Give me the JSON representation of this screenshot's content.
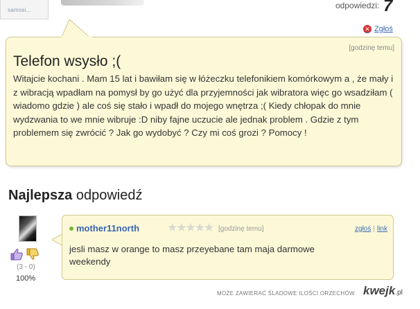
{
  "top": {
    "avatar_caption": "samosi...",
    "answers_label": "odpowiedzi:",
    "answers_count": "7"
  },
  "report": {
    "label": "Zgłoś",
    "icon": "close-circle-icon"
  },
  "question": {
    "time": "[godzinę temu]",
    "title": "Telefon wsysło ;(",
    "body": "Witajcie kochani . Mam 15 lat i bawiłam się w łóżeczku telefonikiem komórkowym a , że mały i z wibracją wpadłam na pomysł by go użyć dla przyjemności jak wibratora więc go wsadziłam ( wiadomo gdzie ) ale coś się stało i wpadł do mojego wnętrza ;( Kiedy chłopak do mnie wydzwania to we mnie wibruje :D niby fajne uczucie ale jednak problem . Gdzie z tym problemem się zwrócić ? Jak go wydobyć ? Czy mi coś grozi ? Pomocy !"
  },
  "best_answer": {
    "heading_bold": "Najlepsza",
    "heading_rest": " odpowiedź",
    "user": "mother11north",
    "stars": "★★★★★",
    "time": "[godzinę temu]",
    "report_link": "zgłoś",
    "link_link": "link",
    "body": "jesli masz w orange to masz przeyebane tam maja darmowe weekendy",
    "votes": "(3 - 0)",
    "percent": "100%"
  },
  "footer": {
    "tagline": "MOŻE ZAWIERAĆ ŚLADOWE ILOŚCI ORZECHÓW",
    "logo": "kwejk",
    "logo_suffix": ".pl"
  },
  "colors": {
    "bubble_bg": "#fdf9d8",
    "bubble_border": "#cfc98e",
    "link": "#3b6cb4",
    "username": "#3865b0",
    "online": "#7bb33c"
  }
}
